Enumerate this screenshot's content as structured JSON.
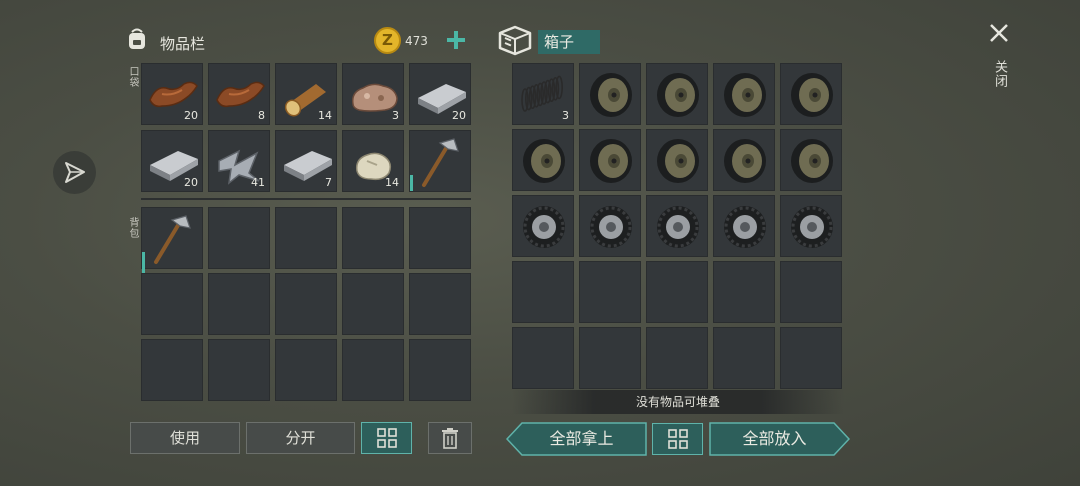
{
  "inventory": {
    "title": "物品栏",
    "coins": "473",
    "pocket_label": "口袋",
    "backpack_label": "背包",
    "pocket_items": [
      {
        "name": "leather-icon",
        "qty": "20"
      },
      {
        "name": "leather-icon",
        "qty": "8"
      },
      {
        "name": "log-icon",
        "qty": "14"
      },
      {
        "name": "ore-icon",
        "qty": "3"
      },
      {
        "name": "iron-ingot-icon",
        "qty": "20"
      },
      {
        "name": "iron-ingot-icon",
        "qty": "20"
      },
      {
        "name": "scrap-metal-icon",
        "qty": "41"
      },
      {
        "name": "iron-ingot-icon",
        "qty": "7"
      },
      {
        "name": "stone-icon",
        "qty": "14"
      },
      {
        "name": "hatchet-icon",
        "qty": ""
      }
    ],
    "backpack_items": [
      {
        "name": "hatchet-icon",
        "qty": ""
      }
    ]
  },
  "box": {
    "title": "箱子",
    "items": [
      {
        "name": "spring-icon",
        "qty": "3"
      },
      {
        "name": "wheel-icon",
        "qty": ""
      },
      {
        "name": "wheel-icon",
        "qty": ""
      },
      {
        "name": "wheel-icon",
        "qty": ""
      },
      {
        "name": "wheel-icon",
        "qty": ""
      },
      {
        "name": "wheel-icon",
        "qty": ""
      },
      {
        "name": "wheel-icon",
        "qty": ""
      },
      {
        "name": "wheel-icon",
        "qty": ""
      },
      {
        "name": "wheel-icon",
        "qty": ""
      },
      {
        "name": "wheel-icon",
        "qty": ""
      },
      {
        "name": "tire-icon",
        "qty": ""
      },
      {
        "name": "tire-icon",
        "qty": ""
      },
      {
        "name": "tire-icon",
        "qty": ""
      },
      {
        "name": "tire-icon",
        "qty": ""
      },
      {
        "name": "tire-icon",
        "qty": ""
      }
    ],
    "stack_notice": "没有物品可堆叠"
  },
  "buttons": {
    "use": "使用",
    "split": "分开",
    "take_all": "全部拿上",
    "put_all": "全部放入"
  },
  "close_label": "关闭",
  "colors": {
    "accent": "#5fb3aa",
    "coin": "#e3b52a"
  }
}
